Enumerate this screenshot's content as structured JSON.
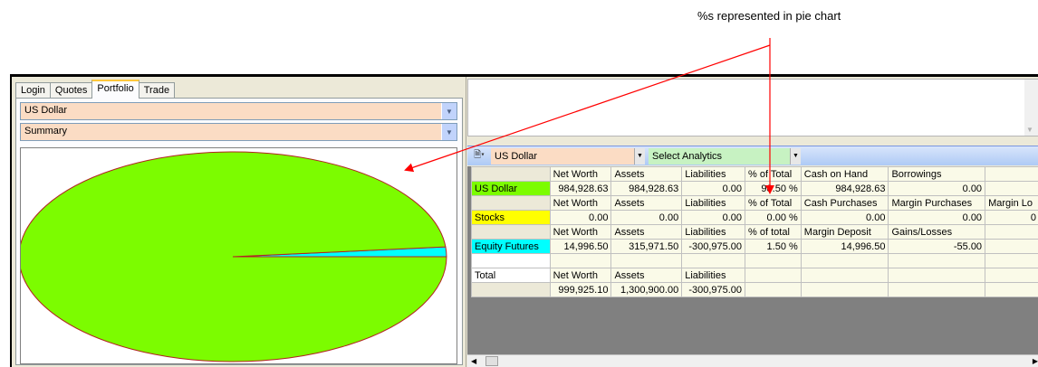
{
  "annotation": {
    "text": "%s represented in pie chart"
  },
  "left_panel": {
    "tabs": [
      {
        "label": "Login",
        "active": false
      },
      {
        "label": "Quotes",
        "active": false
      },
      {
        "label": "Portfolio",
        "active": true
      },
      {
        "label": "Trade",
        "active": false
      }
    ],
    "currency_select": {
      "value": "US Dollar"
    },
    "view_select": {
      "value": "Summary"
    }
  },
  "chart_data": {
    "type": "pie",
    "categories": [
      "US Dollar",
      "Equity Futures"
    ],
    "values": [
      98.5,
      1.5
    ],
    "colors": [
      "#7cfc00",
      "#00ffff"
    ]
  },
  "right_panel": {
    "toolbar": {
      "doc_icon": "document-icon",
      "currency": "US Dollar",
      "analytics": "Select Analytics"
    },
    "grid": {
      "rows": [
        {
          "label": "",
          "label_style": "rh",
          "cells": [
            "Net Worth",
            "Assets",
            "Liabilities",
            "% of Total",
            "Cash on Hand",
            "Borrowings",
            ""
          ],
          "kind": "hd"
        },
        {
          "label": "US Dollar",
          "label_style": "usd",
          "cells": [
            "984,928.63",
            "984,928.63",
            "0.00",
            "98.50 %",
            "984,928.63",
            "0.00",
            ""
          ],
          "kind": "num"
        },
        {
          "label": "",
          "label_style": "rh",
          "cells": [
            "Net Worth",
            "Assets",
            "Liabilities",
            "% of Total",
            "Cash Purchases",
            "Margin Purchases",
            "Margin Lo"
          ],
          "kind": "hd"
        },
        {
          "label": "Stocks",
          "label_style": "stk",
          "cells": [
            "0.00",
            "0.00",
            "0.00",
            "0.00 %",
            "0.00",
            "0.00",
            "0"
          ],
          "kind": "num"
        },
        {
          "label": "",
          "label_style": "rh",
          "cells": [
            "Net Worth",
            "Assets",
            "Liabilities",
            "% of total",
            "Margin Deposit",
            "Gains/Losses",
            ""
          ],
          "kind": "hd"
        },
        {
          "label": "Equity Futures",
          "label_style": "eqf",
          "cells": [
            "14,996.50",
            "315,971.50",
            "-300,975.00",
            "1.50 %",
            "14,996.50",
            "-55.00",
            ""
          ],
          "kind": "num"
        },
        {
          "label": "",
          "label_style": "rhw",
          "cells": [
            "",
            "",
            "",
            "",
            "",
            "",
            ""
          ],
          "kind": "hd"
        },
        {
          "label": "Total",
          "label_style": "rhw",
          "cells": [
            "Net Worth",
            "Assets",
            "Liabilities",
            "",
            "",
            "",
            ""
          ],
          "kind": "hd"
        },
        {
          "label": "",
          "label_style": "rh",
          "cells": [
            "999,925.10",
            "1,300,900.00",
            "-300,975.00",
            "",
            "",
            "",
            ""
          ],
          "kind": "num"
        }
      ]
    }
  }
}
